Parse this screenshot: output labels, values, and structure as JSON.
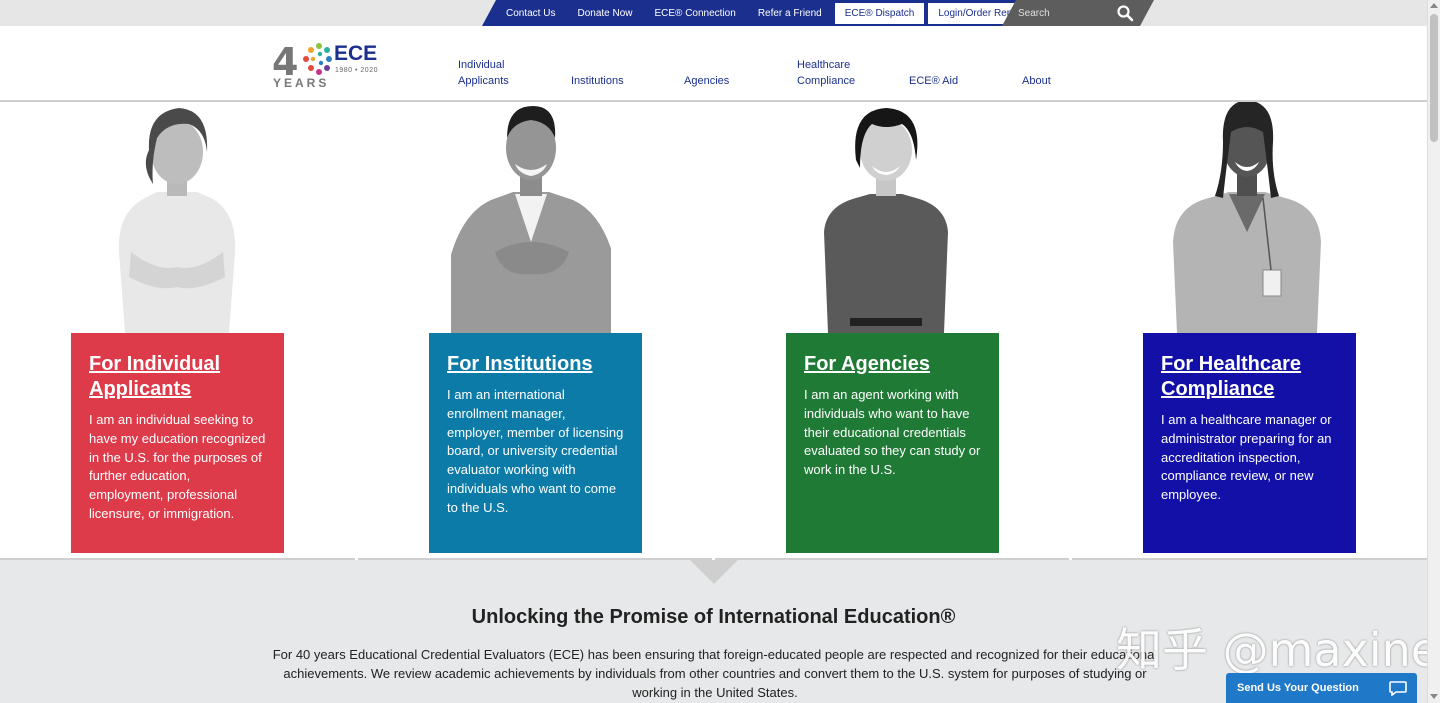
{
  "topbar": {
    "links": [
      "Contact Us",
      "Donate Now",
      "ECE® Connection",
      "Refer a Friend"
    ],
    "buttons": [
      "ECE® Dispatch",
      "Login/Order Report"
    ],
    "search_placeholder": "Search"
  },
  "logo": {
    "number": "4",
    "years": "YEARS",
    "brand": "ECE",
    "dates": "1980 • 2020"
  },
  "nav": {
    "individual_line1": "Individual",
    "individual_line2": "Applicants",
    "institutions": "Institutions",
    "agencies": "Agencies",
    "healthcare_line1": "Healthcare",
    "healthcare_line2": "Compliance",
    "aid": "ECE® Aid",
    "about": "About"
  },
  "cards": [
    {
      "title": "For Individual Applicants",
      "text": "I am an individual seeking to have my education recognized in the U.S. for the purposes of further education, employment, professional licensure, or immigration.",
      "color": "#dd3a4a"
    },
    {
      "title": "For Institutions",
      "text": "I am an international enrollment manager, employer, member of licensing board, or university credential evaluator working with individuals who want to come to the U.S.",
      "color": "#0c7ba8"
    },
    {
      "title": "For Agencies",
      "text": "I am an agent working with individuals who want to have their educational credentials evaluated so they can study or work in the U.S.",
      "color": "#1f7a36"
    },
    {
      "title": "For Healthcare Compliance",
      "text": "I am a healthcare manager or administrator preparing for an accreditation inspection, compliance review, or new employee.",
      "color": "#1210a6"
    }
  ],
  "section": {
    "headline": "Unlocking the Promise of International Education®",
    "lead": "For 40 years Educational Credential Evaluators (ECE) has been ensuring that foreign-educated people are respected and recognized for their educational achievements.  We review academic achievements by individuals from other countries and convert them to the U.S. system for purposes of studying or working in the United States."
  },
  "watermark": "知乎 @maxine",
  "chat": {
    "label": "Send Us Your Question"
  },
  "colors": {
    "brand_blue": "#1b2f8e",
    "chat_blue": "#1f78c8"
  }
}
